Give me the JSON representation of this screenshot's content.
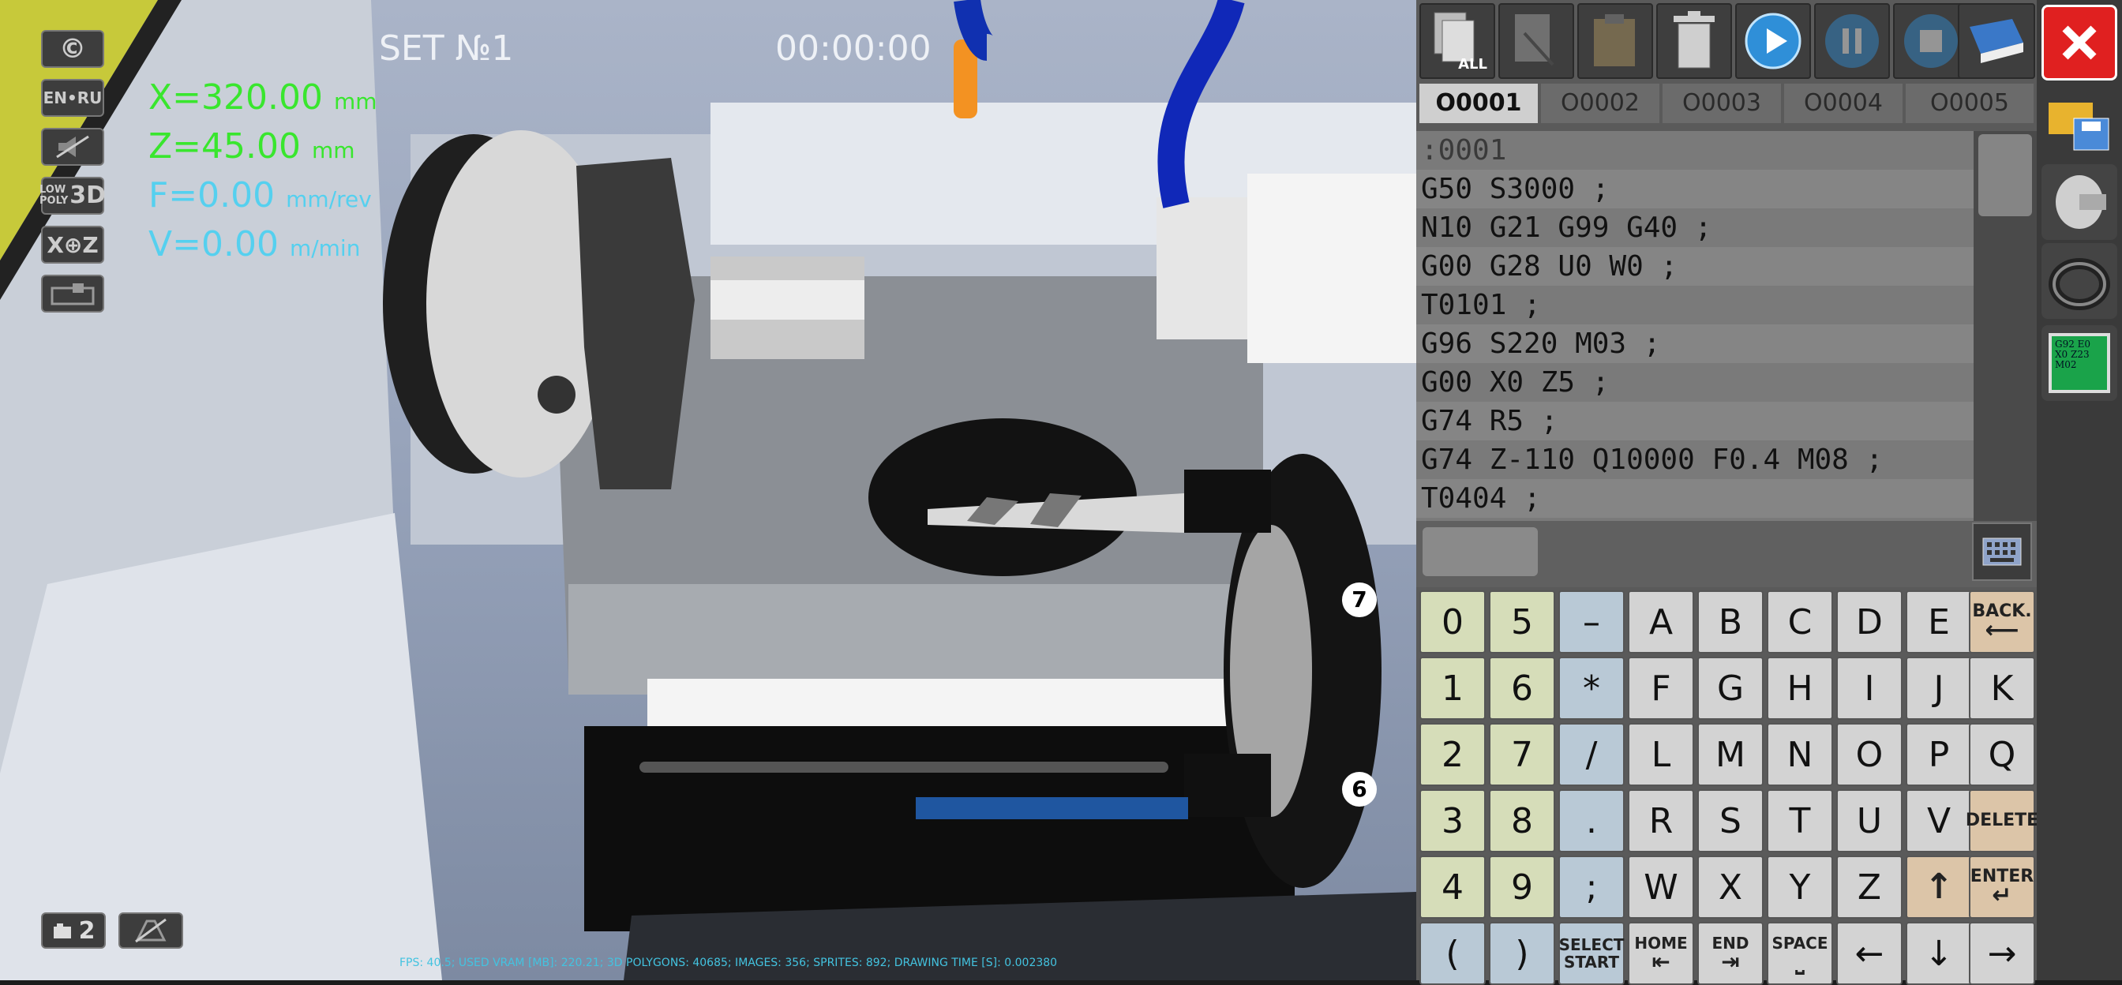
{
  "hud": {
    "set_label": "SET №1",
    "timer": "00:00:00",
    "copyright_btn": "©",
    "lang_btn": "EN•RU",
    "lowpoly_btn_top": "LOW",
    "lowpoly_btn_mid": "POLY",
    "lowpoly_btn_3d": "3D",
    "axis_btn": "X⊕Z",
    "camera_label": "2"
  },
  "readouts": {
    "x_value": "X=320.00",
    "x_unit": "mm",
    "z_value": "Z=45.00",
    "z_unit": "mm",
    "f_value": "F=0.00",
    "f_unit": "mm/rev",
    "v_value": "V=0.00",
    "v_unit": "m/min"
  },
  "tool_numbers": {
    "upper": "7",
    "lower": "6"
  },
  "status_bar": "FPS: 40.5; USED VRAM [MB]: 220.21; 3D POLYGONS: 40685; IMAGES: 356; SPRITES: 892; DRAWING TIME [S]: 0.002380",
  "toolbar": {
    "copy_all_label": "ALL"
  },
  "tabs": [
    "O0001",
    "O0002",
    "O0003",
    "O0004",
    "O0005"
  ],
  "program_lines": [
    ":0001",
    "G50 S3000 ;",
    "N10 G21 G99 G40 ;",
    "G00 G28 U0 W0 ;",
    "T0101 ;",
    "G96 S220 M03 ;",
    "G00 X0 Z5 ;",
    "G74 R5 ;",
    "G74 Z-110 Q10000 F0.4 M08 ;",
    "T0404 ;"
  ],
  "keypad": {
    "row1": [
      "0",
      "5",
      "–",
      "A",
      "B",
      "C",
      "D",
      "E",
      "BACK."
    ],
    "row2": [
      "1",
      "6",
      "*",
      "F",
      "G",
      "H",
      "I",
      "J",
      "K"
    ],
    "row3": [
      "2",
      "7",
      "/",
      "L",
      "M",
      "N",
      "O",
      "P",
      "Q"
    ],
    "row4": [
      "3",
      "8",
      ".",
      "R",
      "S",
      "T",
      "U",
      "V",
      "DELETE"
    ],
    "row5": [
      "4",
      "9",
      ";",
      "W",
      "X",
      "Y",
      "Z",
      "↑",
      "ENTER"
    ],
    "row6": [
      "(",
      ")",
      "SELECT START",
      "HOME",
      "END",
      "SPACE",
      "←",
      "↓",
      "→"
    ]
  },
  "side": {
    "mini_screen_text": "G92 E0 X0 Z23 M02"
  },
  "colors": {
    "readout_green": "#39e62e",
    "readout_cyan": "#55d0ef",
    "close_red": "#e02020"
  }
}
